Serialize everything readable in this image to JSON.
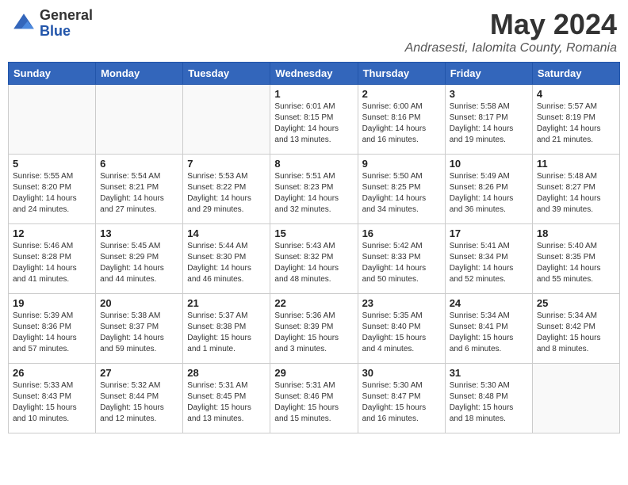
{
  "header": {
    "logo_general": "General",
    "logo_blue": "Blue",
    "month_year": "May 2024",
    "location": "Andrasesti, Ialomita County, Romania"
  },
  "days_of_week": [
    "Sunday",
    "Monday",
    "Tuesday",
    "Wednesday",
    "Thursday",
    "Friday",
    "Saturday"
  ],
  "weeks": [
    [
      {
        "day": "",
        "info": ""
      },
      {
        "day": "",
        "info": ""
      },
      {
        "day": "",
        "info": ""
      },
      {
        "day": "1",
        "info": "Sunrise: 6:01 AM\nSunset: 8:15 PM\nDaylight: 14 hours\nand 13 minutes."
      },
      {
        "day": "2",
        "info": "Sunrise: 6:00 AM\nSunset: 8:16 PM\nDaylight: 14 hours\nand 16 minutes."
      },
      {
        "day": "3",
        "info": "Sunrise: 5:58 AM\nSunset: 8:17 PM\nDaylight: 14 hours\nand 19 minutes."
      },
      {
        "day": "4",
        "info": "Sunrise: 5:57 AM\nSunset: 8:19 PM\nDaylight: 14 hours\nand 21 minutes."
      }
    ],
    [
      {
        "day": "5",
        "info": "Sunrise: 5:55 AM\nSunset: 8:20 PM\nDaylight: 14 hours\nand 24 minutes."
      },
      {
        "day": "6",
        "info": "Sunrise: 5:54 AM\nSunset: 8:21 PM\nDaylight: 14 hours\nand 27 minutes."
      },
      {
        "day": "7",
        "info": "Sunrise: 5:53 AM\nSunset: 8:22 PM\nDaylight: 14 hours\nand 29 minutes."
      },
      {
        "day": "8",
        "info": "Sunrise: 5:51 AM\nSunset: 8:23 PM\nDaylight: 14 hours\nand 32 minutes."
      },
      {
        "day": "9",
        "info": "Sunrise: 5:50 AM\nSunset: 8:25 PM\nDaylight: 14 hours\nand 34 minutes."
      },
      {
        "day": "10",
        "info": "Sunrise: 5:49 AM\nSunset: 8:26 PM\nDaylight: 14 hours\nand 36 minutes."
      },
      {
        "day": "11",
        "info": "Sunrise: 5:48 AM\nSunset: 8:27 PM\nDaylight: 14 hours\nand 39 minutes."
      }
    ],
    [
      {
        "day": "12",
        "info": "Sunrise: 5:46 AM\nSunset: 8:28 PM\nDaylight: 14 hours\nand 41 minutes."
      },
      {
        "day": "13",
        "info": "Sunrise: 5:45 AM\nSunset: 8:29 PM\nDaylight: 14 hours\nand 44 minutes."
      },
      {
        "day": "14",
        "info": "Sunrise: 5:44 AM\nSunset: 8:30 PM\nDaylight: 14 hours\nand 46 minutes."
      },
      {
        "day": "15",
        "info": "Sunrise: 5:43 AM\nSunset: 8:32 PM\nDaylight: 14 hours\nand 48 minutes."
      },
      {
        "day": "16",
        "info": "Sunrise: 5:42 AM\nSunset: 8:33 PM\nDaylight: 14 hours\nand 50 minutes."
      },
      {
        "day": "17",
        "info": "Sunrise: 5:41 AM\nSunset: 8:34 PM\nDaylight: 14 hours\nand 52 minutes."
      },
      {
        "day": "18",
        "info": "Sunrise: 5:40 AM\nSunset: 8:35 PM\nDaylight: 14 hours\nand 55 minutes."
      }
    ],
    [
      {
        "day": "19",
        "info": "Sunrise: 5:39 AM\nSunset: 8:36 PM\nDaylight: 14 hours\nand 57 minutes."
      },
      {
        "day": "20",
        "info": "Sunrise: 5:38 AM\nSunset: 8:37 PM\nDaylight: 14 hours\nand 59 minutes."
      },
      {
        "day": "21",
        "info": "Sunrise: 5:37 AM\nSunset: 8:38 PM\nDaylight: 15 hours\nand 1 minute."
      },
      {
        "day": "22",
        "info": "Sunrise: 5:36 AM\nSunset: 8:39 PM\nDaylight: 15 hours\nand 3 minutes."
      },
      {
        "day": "23",
        "info": "Sunrise: 5:35 AM\nSunset: 8:40 PM\nDaylight: 15 hours\nand 4 minutes."
      },
      {
        "day": "24",
        "info": "Sunrise: 5:34 AM\nSunset: 8:41 PM\nDaylight: 15 hours\nand 6 minutes."
      },
      {
        "day": "25",
        "info": "Sunrise: 5:34 AM\nSunset: 8:42 PM\nDaylight: 15 hours\nand 8 minutes."
      }
    ],
    [
      {
        "day": "26",
        "info": "Sunrise: 5:33 AM\nSunset: 8:43 PM\nDaylight: 15 hours\nand 10 minutes."
      },
      {
        "day": "27",
        "info": "Sunrise: 5:32 AM\nSunset: 8:44 PM\nDaylight: 15 hours\nand 12 minutes."
      },
      {
        "day": "28",
        "info": "Sunrise: 5:31 AM\nSunset: 8:45 PM\nDaylight: 15 hours\nand 13 minutes."
      },
      {
        "day": "29",
        "info": "Sunrise: 5:31 AM\nSunset: 8:46 PM\nDaylight: 15 hours\nand 15 minutes."
      },
      {
        "day": "30",
        "info": "Sunrise: 5:30 AM\nSunset: 8:47 PM\nDaylight: 15 hours\nand 16 minutes."
      },
      {
        "day": "31",
        "info": "Sunrise: 5:30 AM\nSunset: 8:48 PM\nDaylight: 15 hours\nand 18 minutes."
      },
      {
        "day": "",
        "info": ""
      }
    ]
  ]
}
